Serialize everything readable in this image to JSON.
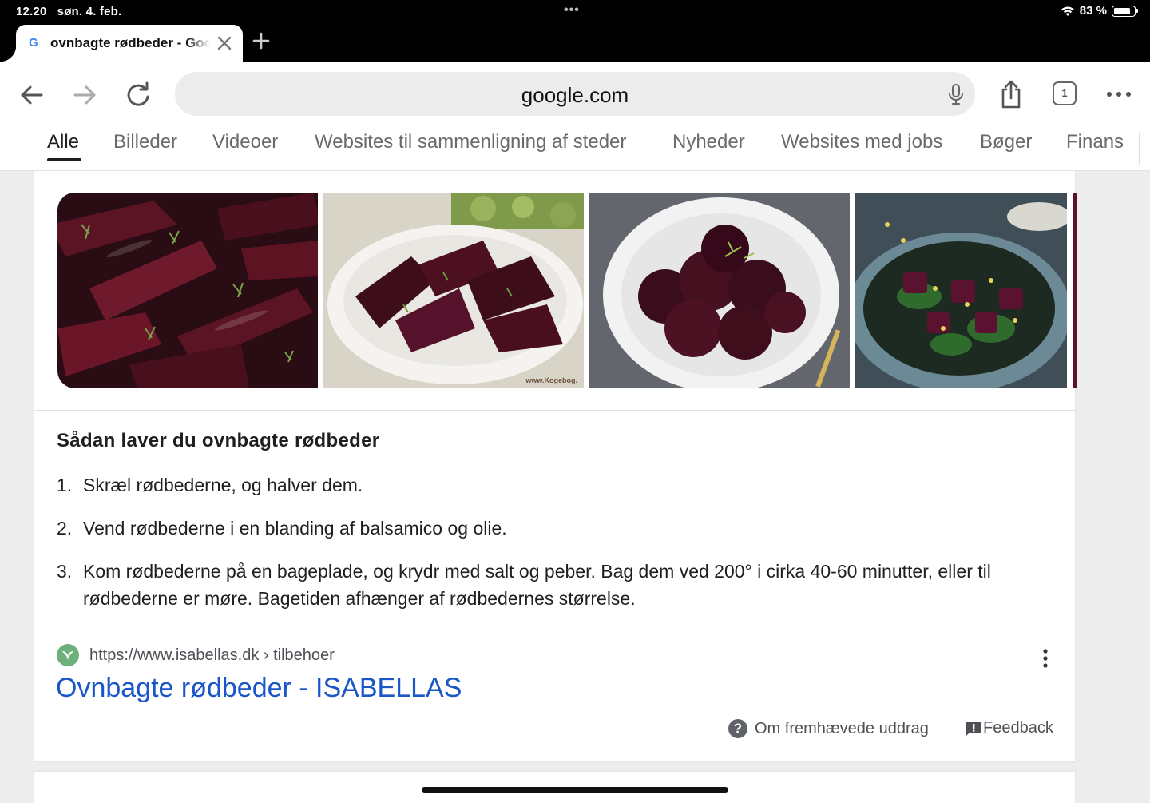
{
  "status_bar": {
    "time": "12.20",
    "date": "søn. 4. feb.",
    "multitask_dots": "•••",
    "battery": "83 %",
    "battery_level": 0.83,
    "wifi_icon": "wifi-icon"
  },
  "tab": {
    "favicon": "G",
    "title": "ovnbagte rødbeder - Google-søgning",
    "close_icon": "close-icon",
    "new_tab_icon": "plus-icon"
  },
  "toolbar": {
    "back_icon": "arrow-left-icon",
    "forward_icon": "arrow-right-icon",
    "reload_icon": "reload-icon",
    "url": "google.com",
    "mic_icon": "microphone-icon",
    "share_icon": "share-icon",
    "tab_count": "1",
    "menu_icon": "more-horizontal-icon"
  },
  "categories": [
    {
      "label": "Alle",
      "active": true
    },
    {
      "label": "Billeder"
    },
    {
      "label": "Videoer"
    },
    {
      "label": "Websites til sammenligning af steder"
    },
    {
      "label": "Nyheder"
    },
    {
      "label": "Websites med jobs"
    },
    {
      "label": "Bøger"
    },
    {
      "label": "Finans"
    }
  ],
  "snippet": {
    "images": [
      {
        "watermark": ""
      },
      {
        "watermark": "www.Kogebog."
      },
      {
        "watermark": ""
      },
      {
        "watermark": ""
      }
    ],
    "title": "Sådan laver du ovnbagte rødbeder",
    "steps": [
      {
        "num": "1.",
        "text": "Skræl rødbederne, og halver dem."
      },
      {
        "num": "2.",
        "text": "Vend rødbederne i en blanding af balsamico og olie."
      },
      {
        "num": "3.",
        "text": "Kom rødbederne på en bageplade, og krydr med salt og peber. Bag dem ved 200° i cirka 40-60 minutter, eller til rødbederne er møre. Bagetiden afhænger af rødbedernes størrelse."
      }
    ],
    "source_url": "https://www.isabellas.dk › tilbehoer",
    "link_title": "Ovnbagte rødbeder - ISABELLAS",
    "about_label": "Om fremhævede uddrag",
    "about_icon": "?",
    "feedback_label": "Feedback",
    "feedback_icon": "!"
  },
  "colors": {
    "link": "#1a56c8",
    "text": "#1f1f1f",
    "muted": "#6a6a6a"
  }
}
